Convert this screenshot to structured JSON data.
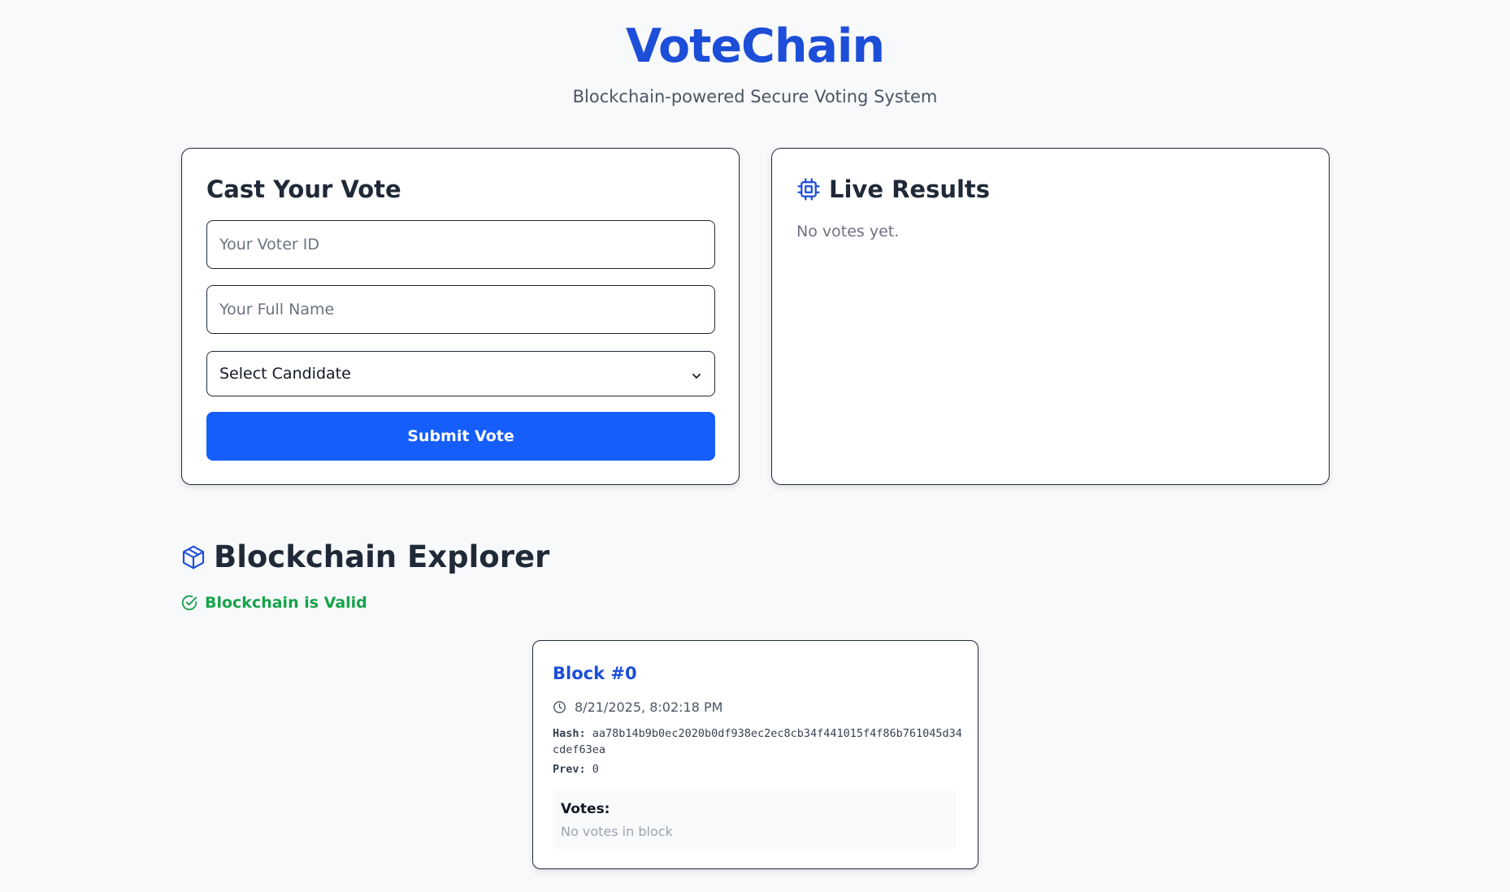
{
  "header": {
    "title": "VoteChain",
    "subtitle": "Blockchain-powered Secure Voting System"
  },
  "vote_form": {
    "title": "Cast Your Vote",
    "voter_id_placeholder": "Your Voter ID",
    "full_name_placeholder": "Your Full Name",
    "candidate_select": "Select Candidate",
    "submit_label": "Submit Vote"
  },
  "results": {
    "title": "Live Results",
    "empty_text": "No votes yet.",
    "icon": "cpu-chip-icon"
  },
  "explorer": {
    "title": "Blockchain Explorer",
    "icon": "cube-icon",
    "status": "Blockchain is Valid",
    "status_icon": "check-circle-icon",
    "blocks": [
      {
        "title": "Block #0",
        "timestamp": "8/21/2025, 8:02:18 PM",
        "hash_label": "Hash:",
        "hash": "aa78b14b9b0ec2020b0df938ec2ec8cb34f441015f4f86b761045d34cdef63ea",
        "prev_label": "Prev:",
        "prev": "0",
        "votes_label": "Votes:",
        "votes_empty": "No votes in block"
      }
    ]
  },
  "colors": {
    "brand": "#1d4ed8",
    "button": "#155efb",
    "valid": "#16a34a",
    "background": "#f8f9fb"
  }
}
